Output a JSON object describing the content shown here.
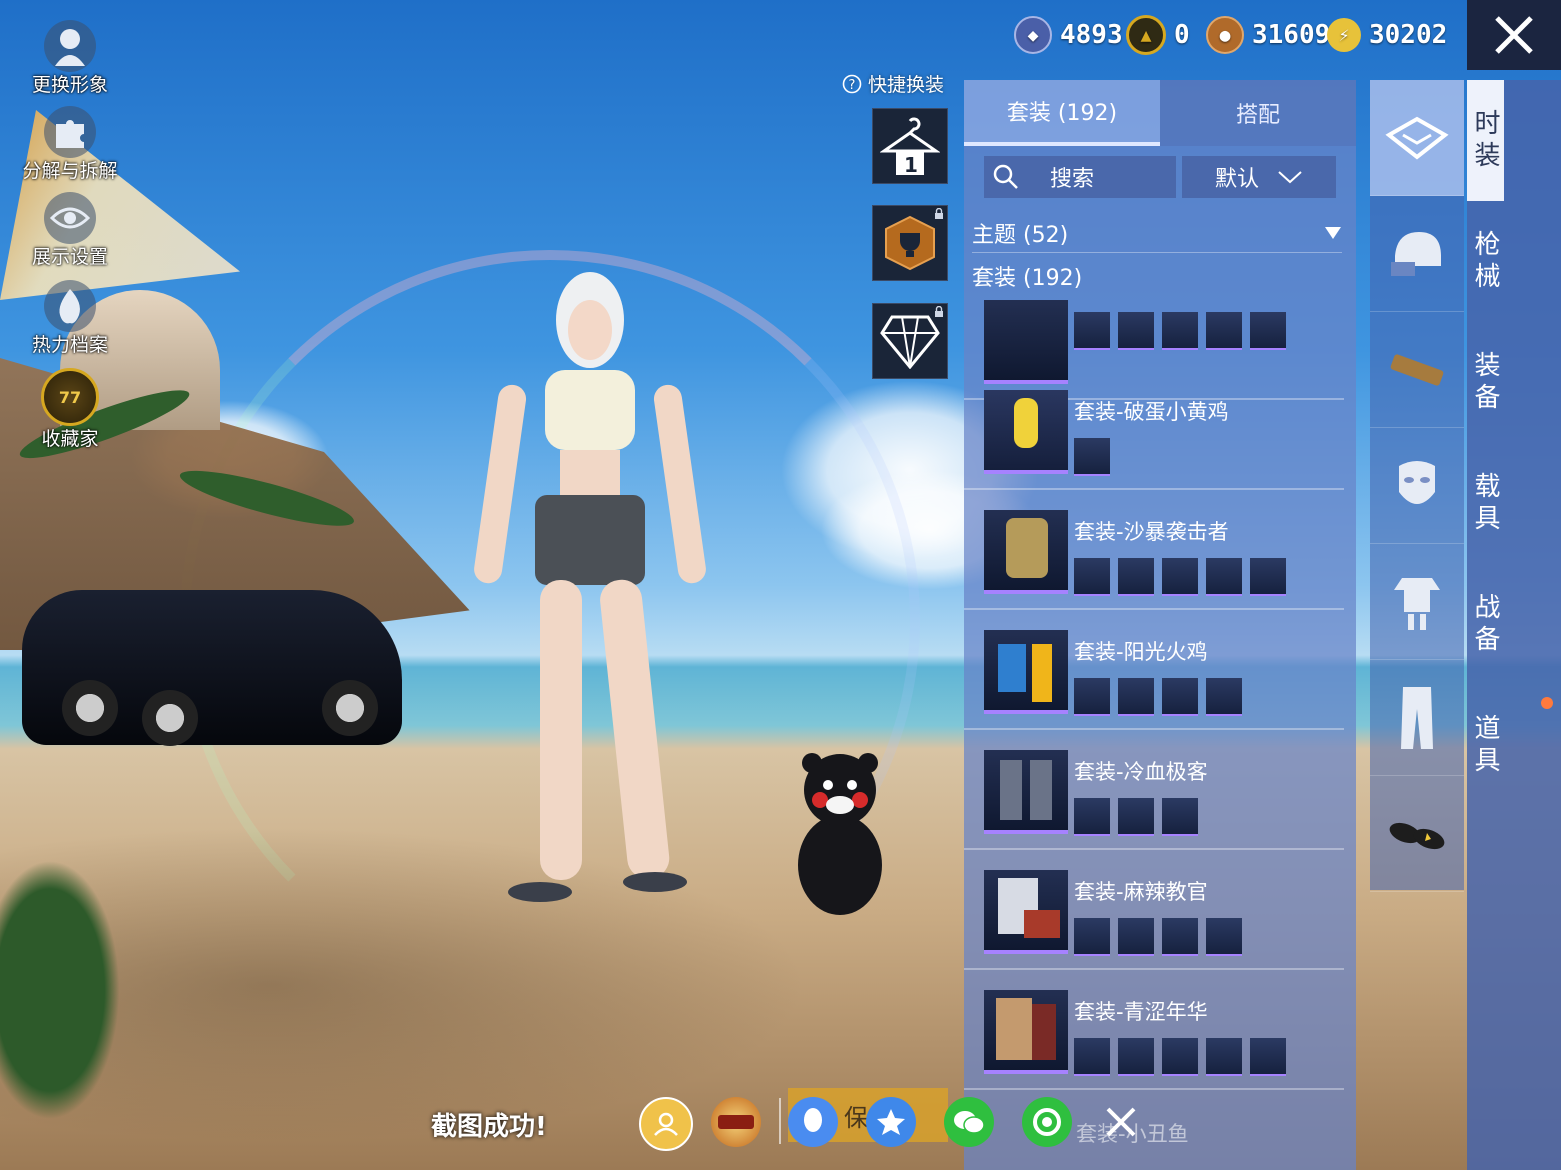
{
  "currencies": [
    {
      "icon": "uc-coin-icon",
      "value": "4893",
      "color": "#6a7fcf"
    },
    {
      "icon": "ag-coin-icon",
      "value": "0",
      "color": "#d6a820"
    },
    {
      "icon": "bp-coin-icon",
      "value": "31609",
      "color": "#b06a2a"
    },
    {
      "icon": "energy-coin-icon",
      "value": "30202",
      "color": "#e7c23a"
    }
  ],
  "left_menu": [
    {
      "icon": "avatar-icon",
      "label": "更换形象"
    },
    {
      "icon": "puzzle-icon",
      "label": "分解与拆解"
    },
    {
      "icon": "eye-icon",
      "label": "展示设置"
    },
    {
      "icon": "flame-icon",
      "label": "热力档案"
    },
    {
      "icon": "collector-badge-icon",
      "label": "收藏家",
      "badge": "77"
    }
  ],
  "quick_change": {
    "label": "快捷换装",
    "slot_number": "1"
  },
  "panel": {
    "tabs": [
      {
        "label": "套装 (192)",
        "active": true
      },
      {
        "label": "搭配",
        "active": false
      }
    ],
    "search_label": "搜索",
    "sort_label": "默认",
    "theme_label": "主题 (52)",
    "section_label": "套装 (192)",
    "outfits": [
      {
        "title": "",
        "item_count": 5
      },
      {
        "title": "套装-破蛋小黄鸡",
        "item_count": 1
      },
      {
        "title": "套装-沙暴袭击者",
        "item_count": 5
      },
      {
        "title": "套装-阳光火鸡",
        "item_count": 4
      },
      {
        "title": "套装-冷血极客",
        "item_count": 3
      },
      {
        "title": "套装-麻辣教官",
        "item_count": 4
      },
      {
        "title": "套装-青涩年华",
        "item_count": 5
      }
    ],
    "partial_last": "套装-小丑鱼"
  },
  "categories": [
    "outfit-box-icon",
    "helmet-icon",
    "belt-icon",
    "mask-icon",
    "costume-icon",
    "pants-icon",
    "slippers-icon"
  ],
  "vertical_tabs": [
    {
      "label": "时装",
      "selected": true
    },
    {
      "label": "枪械",
      "selected": false
    },
    {
      "label": "装备",
      "selected": false
    },
    {
      "label": "载具",
      "selected": false
    },
    {
      "label": "战备",
      "selected": false
    },
    {
      "label": "道具",
      "selected": false
    }
  ],
  "share_bar": {
    "screenshot_text": "截图成功!",
    "save_label": "保存",
    "buttons": [
      "friends-icon",
      "game-elite-icon",
      "qq-icon",
      "qzone-icon",
      "wechat-icon",
      "moments-icon",
      "close-icon"
    ]
  }
}
